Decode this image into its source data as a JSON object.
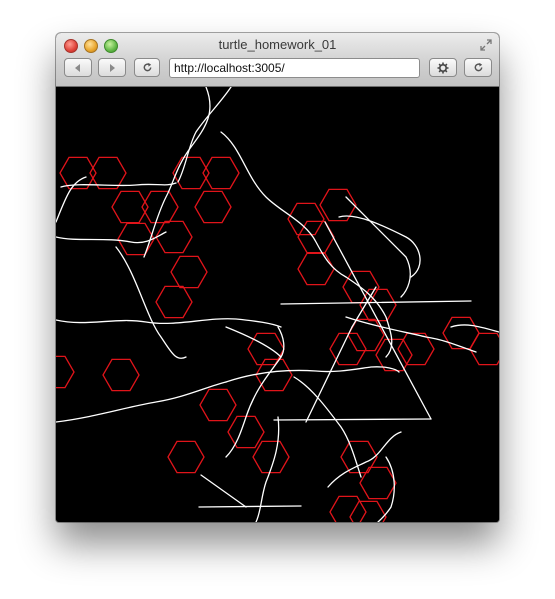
{
  "window": {
    "title": "turtle_homework_01"
  },
  "toolbar": {
    "url": "http://localhost:3005/",
    "back_icon": "back-arrow-icon",
    "forward_icon": "forward-arrow-icon",
    "reload_icon": "reload-icon",
    "settings_icon": "gear-icon"
  },
  "canvas": {
    "background": "#000000",
    "hexagon_color": "#e0141a",
    "line_color": "#ffffff"
  }
}
